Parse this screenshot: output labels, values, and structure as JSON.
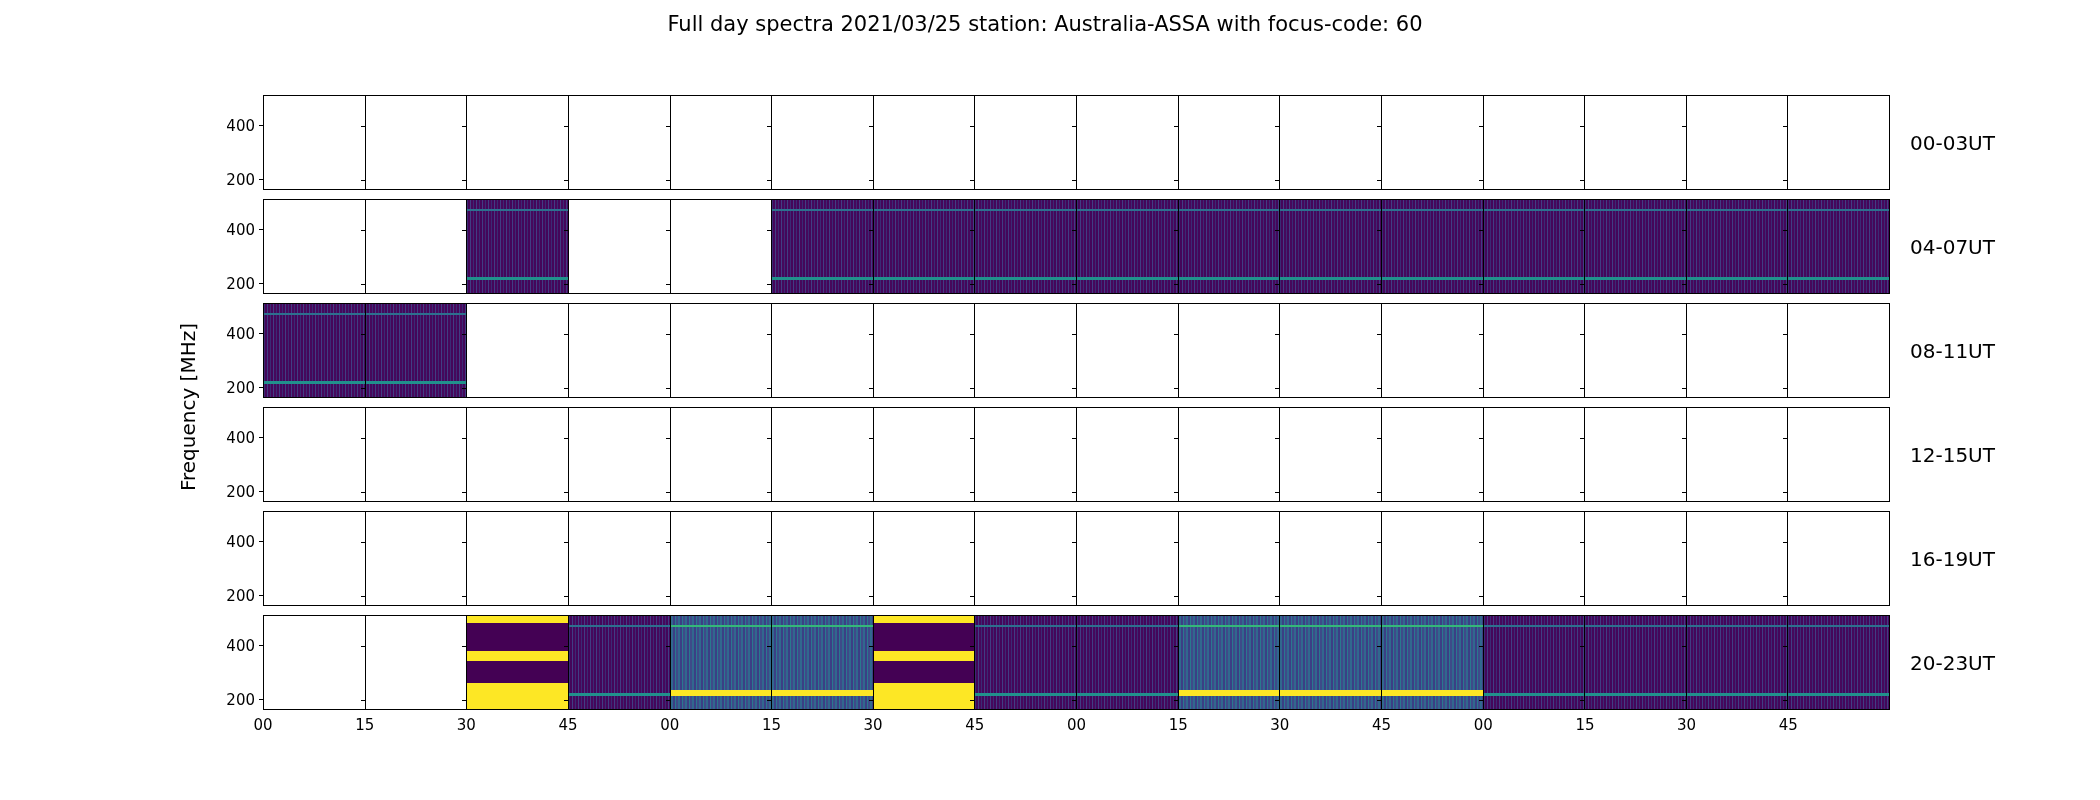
{
  "figure": {
    "title": "Full day spectra 2021/03/25 station: Australia-ASSA with focus-code: 60",
    "ylabel": "Frequency [MHz]",
    "xticks": [
      "00",
      "15",
      "30",
      "45",
      "00",
      "15",
      "30",
      "45",
      "00",
      "15",
      "30",
      "45",
      "00",
      "15",
      "30",
      "45"
    ],
    "rows": [
      {
        "label": "00-03UT",
        "yticks": [
          "400",
          "200"
        ],
        "panels": [
          {
            "kind": "empty"
          },
          {
            "kind": "empty"
          },
          {
            "kind": "empty"
          },
          {
            "kind": "empty"
          },
          {
            "kind": "empty"
          },
          {
            "kind": "empty"
          },
          {
            "kind": "empty"
          },
          {
            "kind": "empty"
          },
          {
            "kind": "empty"
          },
          {
            "kind": "empty"
          },
          {
            "kind": "empty"
          },
          {
            "kind": "empty"
          },
          {
            "kind": "empty"
          },
          {
            "kind": "empty"
          },
          {
            "kind": "empty"
          },
          {
            "kind": "empty"
          }
        ]
      },
      {
        "label": "04-07UT",
        "yticks": [
          "400",
          "200"
        ],
        "panels": [
          {
            "kind": "empty"
          },
          {
            "kind": "empty"
          },
          {
            "kind": "spectrum"
          },
          {
            "kind": "empty"
          },
          {
            "kind": "empty"
          },
          {
            "kind": "spectrum"
          },
          {
            "kind": "spectrum"
          },
          {
            "kind": "spectrum"
          },
          {
            "kind": "spectrum"
          },
          {
            "kind": "spectrum"
          },
          {
            "kind": "spectrum"
          },
          {
            "kind": "spectrum"
          },
          {
            "kind": "spectrum"
          },
          {
            "kind": "spectrum"
          },
          {
            "kind": "spectrum"
          },
          {
            "kind": "spectrum"
          }
        ]
      },
      {
        "label": "08-11UT",
        "yticks": [
          "400",
          "200"
        ],
        "panels": [
          {
            "kind": "spectrum"
          },
          {
            "kind": "spectrum"
          },
          {
            "kind": "empty"
          },
          {
            "kind": "empty"
          },
          {
            "kind": "empty"
          },
          {
            "kind": "empty"
          },
          {
            "kind": "empty"
          },
          {
            "kind": "empty"
          },
          {
            "kind": "empty"
          },
          {
            "kind": "empty"
          },
          {
            "kind": "empty"
          },
          {
            "kind": "empty"
          },
          {
            "kind": "empty"
          },
          {
            "kind": "empty"
          },
          {
            "kind": "empty"
          },
          {
            "kind": "empty"
          }
        ]
      },
      {
        "label": "12-15UT",
        "yticks": [
          "400",
          "200"
        ],
        "panels": [
          {
            "kind": "empty"
          },
          {
            "kind": "empty"
          },
          {
            "kind": "empty"
          },
          {
            "kind": "empty"
          },
          {
            "kind": "empty"
          },
          {
            "kind": "empty"
          },
          {
            "kind": "empty"
          },
          {
            "kind": "empty"
          },
          {
            "kind": "empty"
          },
          {
            "kind": "empty"
          },
          {
            "kind": "empty"
          },
          {
            "kind": "empty"
          },
          {
            "kind": "empty"
          },
          {
            "kind": "empty"
          },
          {
            "kind": "empty"
          },
          {
            "kind": "empty"
          }
        ]
      },
      {
        "label": "16-19UT",
        "yticks": [
          "400",
          "200"
        ],
        "panels": [
          {
            "kind": "empty"
          },
          {
            "kind": "empty"
          },
          {
            "kind": "empty"
          },
          {
            "kind": "empty"
          },
          {
            "kind": "empty"
          },
          {
            "kind": "empty"
          },
          {
            "kind": "empty"
          },
          {
            "kind": "empty"
          },
          {
            "kind": "empty"
          },
          {
            "kind": "empty"
          },
          {
            "kind": "empty"
          },
          {
            "kind": "empty"
          },
          {
            "kind": "empty"
          },
          {
            "kind": "empty"
          },
          {
            "kind": "empty"
          },
          {
            "kind": "empty"
          }
        ]
      },
      {
        "label": "20-23UT",
        "yticks": [
          "400",
          "200"
        ],
        "panels": [
          {
            "kind": "empty"
          },
          {
            "kind": "empty"
          },
          {
            "kind": "saturated"
          },
          {
            "kind": "spectrum"
          },
          {
            "kind": "bright"
          },
          {
            "kind": "bright"
          },
          {
            "kind": "saturated"
          },
          {
            "kind": "spectrum"
          },
          {
            "kind": "spectrum"
          },
          {
            "kind": "bright"
          },
          {
            "kind": "bright"
          },
          {
            "kind": "bright"
          },
          {
            "kind": "spectrum"
          },
          {
            "kind": "spectrum"
          },
          {
            "kind": "spectrum"
          },
          {
            "kind": "spectrum"
          }
        ]
      }
    ]
  }
}
